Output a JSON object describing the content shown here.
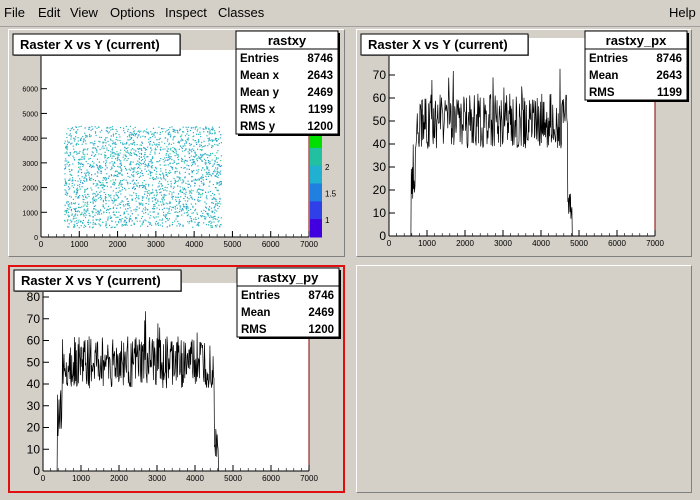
{
  "menu": {
    "file": "File",
    "edit": "Edit",
    "view": "View",
    "options": "Options",
    "inspect": "Inspect",
    "classes": "Classes",
    "help": "Help"
  },
  "colors": {
    "scatter": "#2bb4c0",
    "frame_selected": "#e01010",
    "axis_frame": "#8b0000"
  },
  "chart_data": [
    {
      "type": "scatter",
      "title": "Raster X vs Y (current)",
      "stats_title": "rastxy",
      "stats": [
        {
          "label": "Entries",
          "value": "8746"
        },
        {
          "label": "Mean x",
          "value": "2643"
        },
        {
          "label": "Mean y",
          "value": "2469"
        },
        {
          "label": "RMS x",
          "value": "1199"
        },
        {
          "label": "RMS y",
          "value": "1200"
        }
      ],
      "xlim": [
        0,
        7000
      ],
      "ylim": [
        0,
        7000
      ],
      "x_ticks": [
        "0",
        "1000",
        "2000",
        "3000",
        "4000",
        "5000",
        "6000",
        "7000"
      ],
      "y_ticks": [
        "0",
        "1000",
        "2000",
        "3000",
        "4000",
        "5000",
        "6000"
      ],
      "fill_region": {
        "x": [
          600,
          4700
        ],
        "y": [
          400,
          4500
        ]
      },
      "colorbar_ticks": [
        "1",
        "1.5",
        "2"
      ]
    },
    {
      "type": "line",
      "title": "Raster X vs Y (current)",
      "stats_title": "rastxy_px",
      "stats": [
        {
          "label": "Entries",
          "value": "8746"
        },
        {
          "label": "Mean",
          "value": "2643"
        },
        {
          "label": "RMS",
          "value": "1199"
        }
      ],
      "xlim": [
        0,
        7000
      ],
      "ylim": [
        0,
        80
      ],
      "x_ticks": [
        "0",
        "1000",
        "2000",
        "3000",
        "4000",
        "5000",
        "6000",
        "7000"
      ],
      "y_ticks": [
        "0",
        "10",
        "20",
        "30",
        "40",
        "50",
        "60",
        "70"
      ],
      "plateau": {
        "x_start": 700,
        "x_end": 4700,
        "mean": 50,
        "spread": 12
      }
    },
    {
      "type": "line",
      "title": "Raster X vs Y (current)",
      "stats_title": "rastxy_py",
      "stats": [
        {
          "label": "Entries",
          "value": "8746"
        },
        {
          "label": "Mean",
          "value": "2469"
        },
        {
          "label": "RMS",
          "value": "1200"
        }
      ],
      "xlim": [
        0,
        7000
      ],
      "ylim": [
        0,
        80
      ],
      "x_ticks": [
        "0",
        "1000",
        "2000",
        "3000",
        "4000",
        "5000",
        "6000",
        "7000"
      ],
      "y_ticks": [
        "0",
        "10",
        "20",
        "30",
        "40",
        "50",
        "60",
        "70",
        "80"
      ],
      "plateau": {
        "x_start": 500,
        "x_end": 4500,
        "mean": 50,
        "spread": 12
      }
    }
  ]
}
